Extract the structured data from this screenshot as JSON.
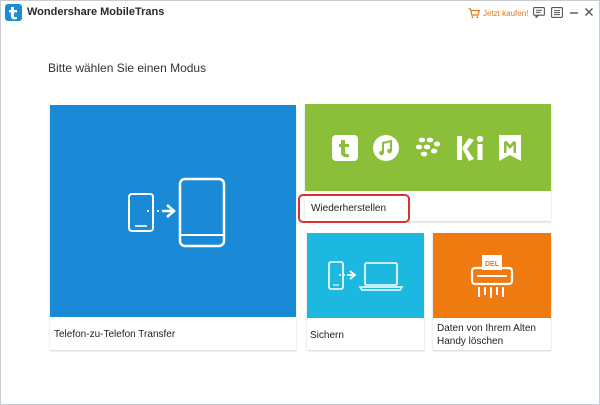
{
  "window": {
    "title": "Wondershare MobileTrans",
    "buy_now_label": "Jetzt kaufen!"
  },
  "main": {
    "subtitle": "Bitte wählen Sie einen Modus"
  },
  "tiles": [
    {
      "label": "Telefon-zu-Telefon Transfer",
      "color": "#1a8ad6"
    },
    {
      "label": "Wiederherstellen",
      "color": "#8bbf3a"
    },
    {
      "label": "Sichern",
      "color": "#1db8e0"
    },
    {
      "label": "Daten von Ihrem Alten Handy löschen",
      "color": "#ef7b10"
    }
  ],
  "restore_icons": [
    "tango-icon",
    "itunes-icon",
    "blackberry-icon",
    "kik-icon",
    "viber-icon"
  ],
  "erase_icon_text": "DEL",
  "colors": {
    "highlight": "#d9322f",
    "buy_accent": "#e07a14"
  }
}
